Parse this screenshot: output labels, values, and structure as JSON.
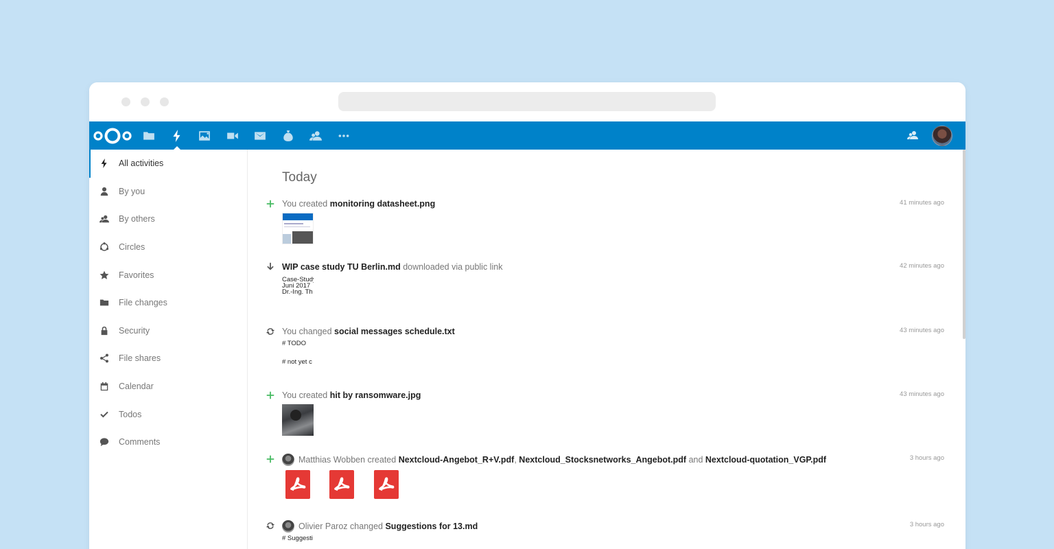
{
  "nav": {
    "items": [
      {
        "label": "All activities",
        "icon": "lightning-icon"
      },
      {
        "label": "By you",
        "icon": "user-icon"
      },
      {
        "label": "By others",
        "icon": "users-icon"
      },
      {
        "label": "Circles",
        "icon": "circles-icon"
      },
      {
        "label": "Favorites",
        "icon": "star-icon"
      },
      {
        "label": "File changes",
        "icon": "folder-icon"
      },
      {
        "label": "Security",
        "icon": "lock-icon"
      },
      {
        "label": "File shares",
        "icon": "share-icon"
      },
      {
        "label": "Calendar",
        "icon": "calendar-icon"
      },
      {
        "label": "Todos",
        "icon": "checkmark-icon"
      },
      {
        "label": "Comments",
        "icon": "comment-icon"
      }
    ]
  },
  "main": {
    "day": "Today",
    "activities": [
      {
        "pre": "You created ",
        "file": "monitoring datasheet.png",
        "time": "41 minutes ago"
      },
      {
        "file": "WIP case study TU Berlin.md",
        "post": " downloaded via public link",
        "time": "42 minutes ago",
        "preview": [
          "Case-Study",
          "Juni 2017",
          "Dr.-Ing. Th"
        ]
      },
      {
        "pre": "You changed ",
        "file": "social messages schedule.txt",
        "time": "43 minutes ago",
        "preview": [
          "# TODO",
          "# not yet c"
        ]
      },
      {
        "pre": "You created ",
        "file": "hit by ransomware.jpg",
        "time": "43 minutes ago"
      },
      {
        "user": "Matthias Wobben",
        "verb": " created ",
        "file1": "Nextcloud-Angebot_R+V.pdf",
        "sep1": ", ",
        "file2": "Nextcloud_Stocksnetworks_Angebot.pdf",
        "sep2": " and ",
        "file3": "Nextcloud-quotation_VGP.pdf",
        "time": "3 hours ago"
      },
      {
        "user": "Olivier Paroz",
        "verb": " changed ",
        "file": "Suggestions for 13.md",
        "time": "3 hours ago",
        "preview": [
          "# Suggesti"
        ]
      }
    ]
  },
  "colors": {
    "accent": "#0082c9",
    "green": "#46ba61",
    "pdf": "#e53935",
    "background": "#c5e1f5"
  }
}
